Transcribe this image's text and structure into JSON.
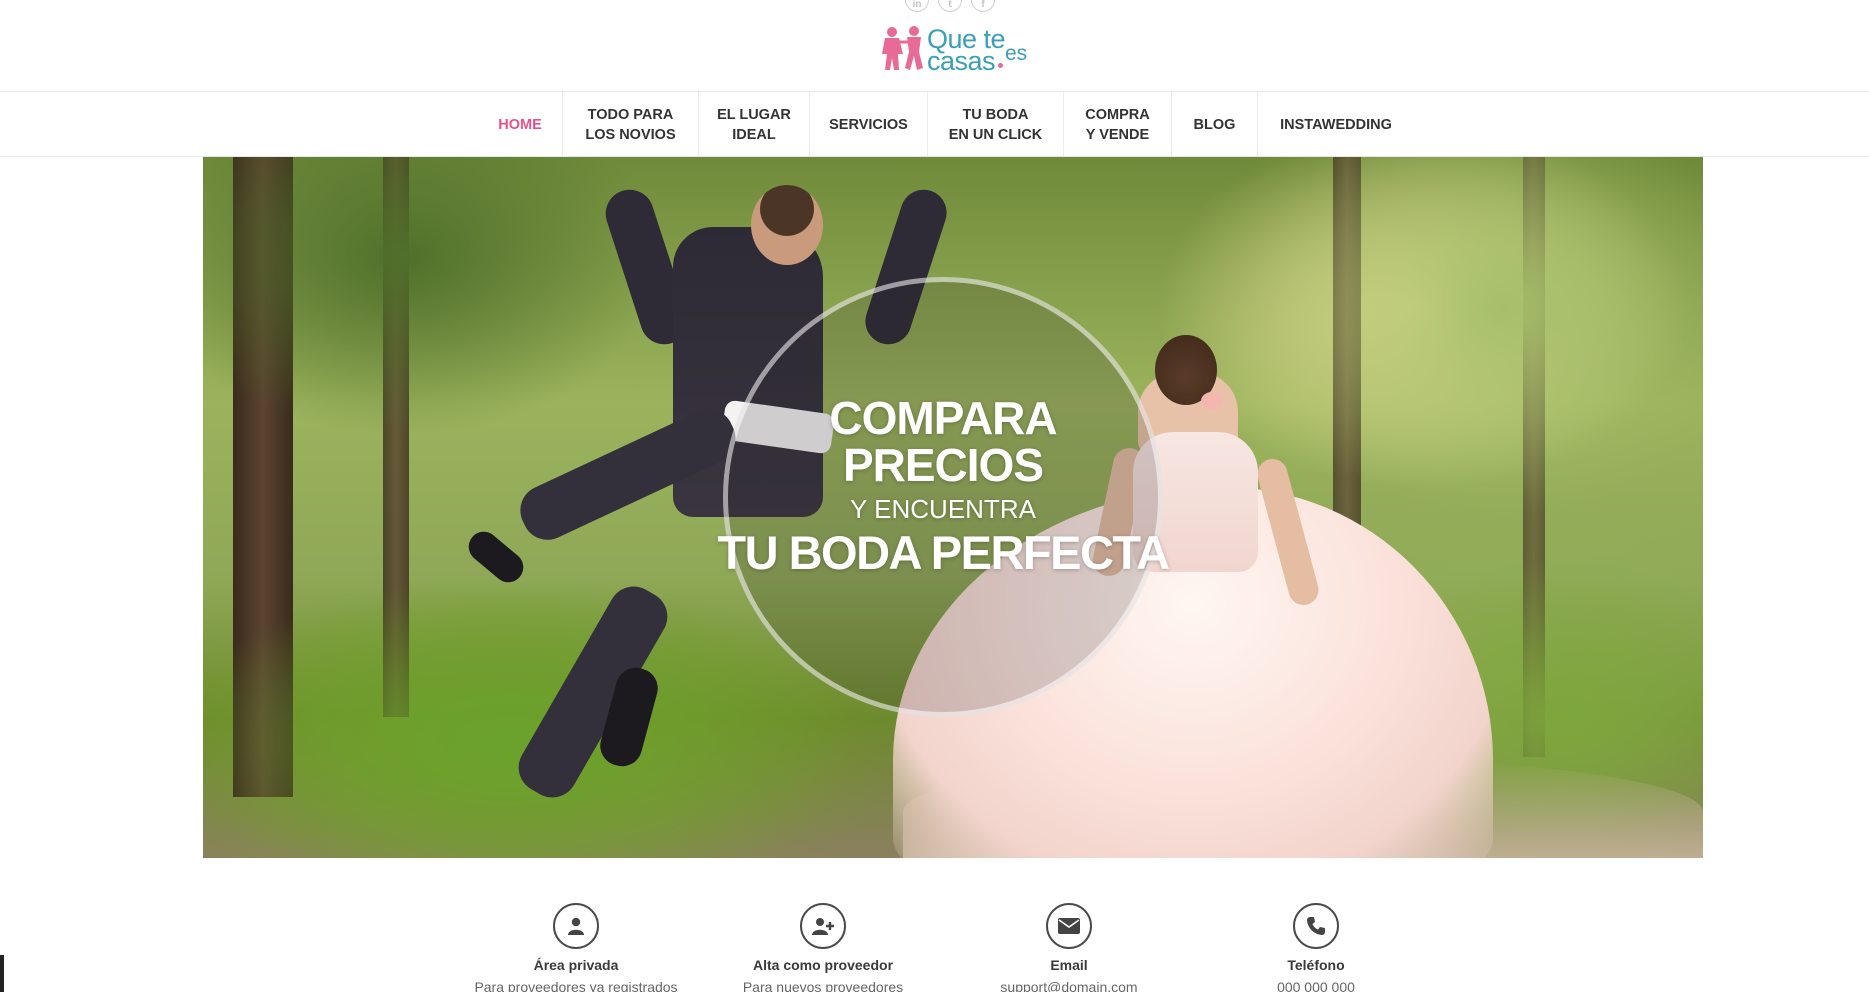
{
  "header": {
    "socials": [
      {
        "icon": "linkedin-icon",
        "glyph": "in"
      },
      {
        "icon": "twitter-icon",
        "glyph": "t"
      },
      {
        "icon": "facebook-icon",
        "glyph": "f"
      }
    ],
    "logo": {
      "line1": "Que te",
      "line2": "casas",
      "suffix": "es",
      "colors": {
        "text": "#3b9fb7",
        "figures": "#e86a96"
      }
    }
  },
  "nav": {
    "items": [
      {
        "label": "HOME",
        "active": true
      },
      {
        "label": "TODO PARA\nLOS NOVIOS"
      },
      {
        "label": "EL LUGAR\nIDEAL"
      },
      {
        "label": "SERVICIOS"
      },
      {
        "label": "TU BODA\nEN UN CLICK"
      },
      {
        "label": "COMPRA\nY VENDE"
      },
      {
        "label": "BLOG"
      },
      {
        "label": "INSTAWEDDING"
      }
    ],
    "active_color": "#e8508c"
  },
  "hero": {
    "line1": "COMPARA",
    "line2": "PRECIOS",
    "line3": "Y ENCUENTRA",
    "line4": "TU BODA PERFECTA"
  },
  "features": [
    {
      "icon": "user-icon",
      "title": "Área privada",
      "subtitle": "Para proveedores ya registrados"
    },
    {
      "icon": "add-user-icon",
      "title": "Alta como proveedor",
      "subtitle": "Para nuevos proveedores"
    },
    {
      "icon": "envelope-icon",
      "title": "Email",
      "subtitle": "support@domain.com"
    },
    {
      "icon": "phone-icon",
      "title": "Teléfono",
      "subtitle": "000 000 000"
    }
  ]
}
